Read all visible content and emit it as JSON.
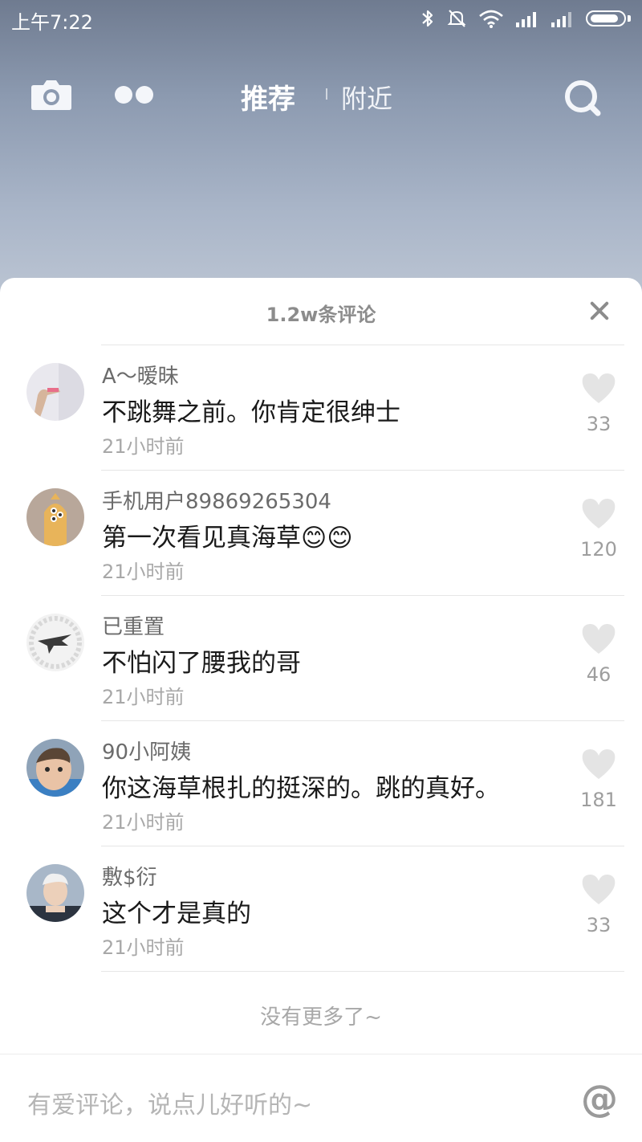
{
  "status_bar": {
    "time": "上午7:22"
  },
  "nav": {
    "tab_recommend": "推荐",
    "tab_nearby": "附近"
  },
  "comments_panel": {
    "title": "1.2w条评论",
    "no_more": "没有更多了~",
    "input_placeholder": "有爱评论，说点儿好听的~",
    "at_symbol": "@",
    "comments": [
      {
        "username": "A～暧昧",
        "text": "不跳舞之前。你肯定很绅士",
        "time": "21小时前",
        "likes": "33"
      },
      {
        "username": "手机用户89869265304",
        "text": "第一次看见真海草😊😊",
        "time": "21小时前",
        "likes": "120"
      },
      {
        "username": "已重置",
        "text": "不怕闪了腰我的哥",
        "time": "21小时前",
        "likes": "46"
      },
      {
        "username": "90小阿姨",
        "text": "你这海草根扎的挺深的。跳的真好。",
        "time": "21小时前",
        "likes": "181"
      },
      {
        "username": "敷$衍",
        "text": "这个才是真的",
        "time": "21小时前",
        "likes": "33"
      }
    ]
  },
  "colors": {
    "sheet_bg": "#ffffff",
    "text_primary": "#1a1a1a",
    "text_secondary": "#8c8c8c",
    "heart": "#e6e6e6"
  },
  "icons": {
    "camera": "camera-icon",
    "dual_dots": "dots-icon",
    "search": "search-icon",
    "close": "close-icon",
    "heart": "heart-icon",
    "bluetooth": "bluetooth-icon",
    "mute": "bell-off-icon",
    "wifi": "wifi-icon",
    "signal": "signal-icon",
    "battery": "battery-icon"
  }
}
